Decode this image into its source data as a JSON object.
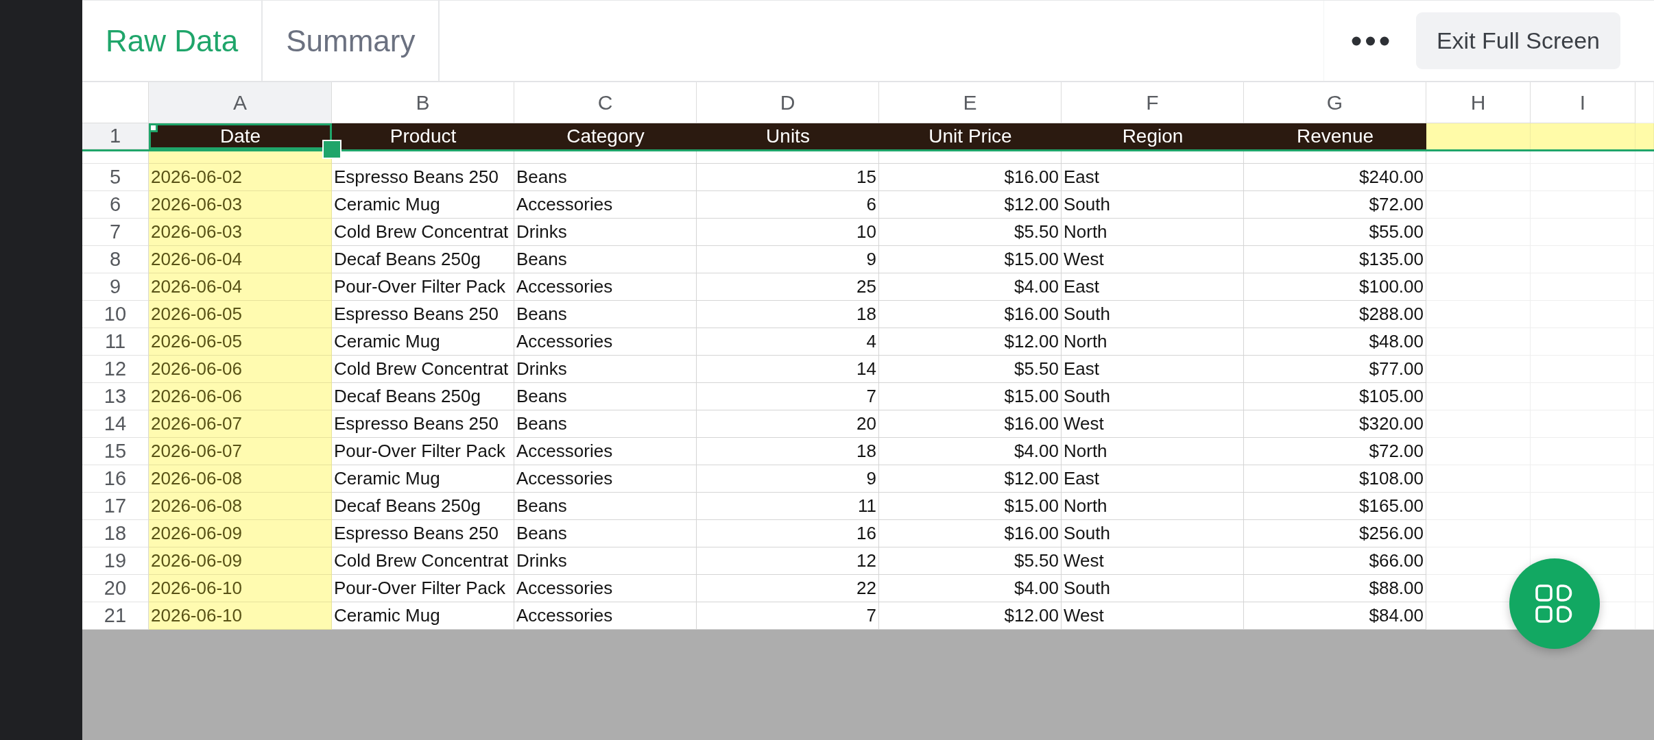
{
  "tabs": [
    {
      "label": "Raw Data",
      "selected": true
    },
    {
      "label": "Summary",
      "selected": false
    }
  ],
  "exit_button": "Exit Full Screen",
  "columns": [
    {
      "letter": "A",
      "kind": "text",
      "highlighted": true
    },
    {
      "letter": "B",
      "kind": "text",
      "highlighted": false
    },
    {
      "letter": "C",
      "kind": "text",
      "highlighted": false
    },
    {
      "letter": "D",
      "kind": "number",
      "highlighted": false
    },
    {
      "letter": "E",
      "kind": "number",
      "highlighted": false
    },
    {
      "letter": "F",
      "kind": "text",
      "highlighted": false
    },
    {
      "letter": "G",
      "kind": "number",
      "highlighted": false
    },
    {
      "letter": "H",
      "highlighted": false
    },
    {
      "letter": "I",
      "highlighted": false
    }
  ],
  "header_row": {
    "number": "1",
    "highlighted": true,
    "cells": [
      {
        "text": "Date",
        "selected": true
      },
      {
        "text": "Product",
        "selected": false
      },
      {
        "text": "Category",
        "selected": false
      },
      {
        "text": "Units",
        "selected": false
      },
      {
        "text": "Unit Price",
        "selected": false
      },
      {
        "text": "Region",
        "selected": false
      },
      {
        "text": "Revenue",
        "selected": false
      }
    ]
  },
  "rows": [
    {
      "number": "5",
      "cells": [
        "2026-06-02",
        "Espresso Beans 250",
        "Beans",
        "15",
        "$16.00",
        "East",
        "$240.00"
      ]
    },
    {
      "number": "6",
      "cells": [
        "2026-06-03",
        "Ceramic Mug",
        "Accessories",
        "6",
        "$12.00",
        "South",
        "$72.00"
      ]
    },
    {
      "number": "7",
      "cells": [
        "2026-06-03",
        "Cold Brew Concentrat",
        "Drinks",
        "10",
        "$5.50",
        "North",
        "$55.00"
      ]
    },
    {
      "number": "8",
      "cells": [
        "2026-06-04",
        "Decaf Beans 250g",
        "Beans",
        "9",
        "$15.00",
        "West",
        "$135.00"
      ]
    },
    {
      "number": "9",
      "cells": [
        "2026-06-04",
        "Pour-Over Filter Pack",
        "Accessories",
        "25",
        "$4.00",
        "East",
        "$100.00"
      ]
    },
    {
      "number": "10",
      "cells": [
        "2026-06-05",
        "Espresso Beans 250",
        "Beans",
        "18",
        "$16.00",
        "South",
        "$288.00"
      ]
    },
    {
      "number": "11",
      "cells": [
        "2026-06-05",
        "Ceramic Mug",
        "Accessories",
        "4",
        "$12.00",
        "North",
        "$48.00"
      ]
    },
    {
      "number": "12",
      "cells": [
        "2026-06-06",
        "Cold Brew Concentrat",
        "Drinks",
        "14",
        "$5.50",
        "East",
        "$77.00"
      ]
    },
    {
      "number": "13",
      "cells": [
        "2026-06-06",
        "Decaf Beans 250g",
        "Beans",
        "7",
        "$15.00",
        "South",
        "$105.00"
      ]
    },
    {
      "number": "14",
      "cells": [
        "2026-06-07",
        "Espresso Beans 250",
        "Beans",
        "20",
        "$16.00",
        "West",
        "$320.00"
      ]
    },
    {
      "number": "15",
      "cells": [
        "2026-06-07",
        "Pour-Over Filter Pack",
        "Accessories",
        "18",
        "$4.00",
        "North",
        "$72.00"
      ]
    },
    {
      "number": "16",
      "cells": [
        "2026-06-08",
        "Ceramic Mug",
        "Accessories",
        "9",
        "$12.00",
        "East",
        "$108.00"
      ]
    },
    {
      "number": "17",
      "cells": [
        "2026-06-08",
        "Decaf Beans 250g",
        "Beans",
        "11",
        "$15.00",
        "North",
        "$165.00"
      ]
    },
    {
      "number": "18",
      "cells": [
        "2026-06-09",
        "Espresso Beans 250",
        "Beans",
        "16",
        "$16.00",
        "South",
        "$256.00"
      ]
    },
    {
      "number": "19",
      "cells": [
        "2026-06-09",
        "Cold Brew Concentrat",
        "Drinks",
        "12",
        "$5.50",
        "West",
        "$66.00"
      ]
    },
    {
      "number": "20",
      "cells": [
        "2026-06-10",
        "Pour-Over Filter Pack",
        "Accessories",
        "22",
        "$4.00",
        "South",
        "$88.00"
      ]
    },
    {
      "number": "21",
      "cells": [
        "2026-06-10",
        "Ceramic Mug",
        "Accessories",
        "7",
        "$12.00",
        "West",
        "$84.00"
      ]
    }
  ]
}
